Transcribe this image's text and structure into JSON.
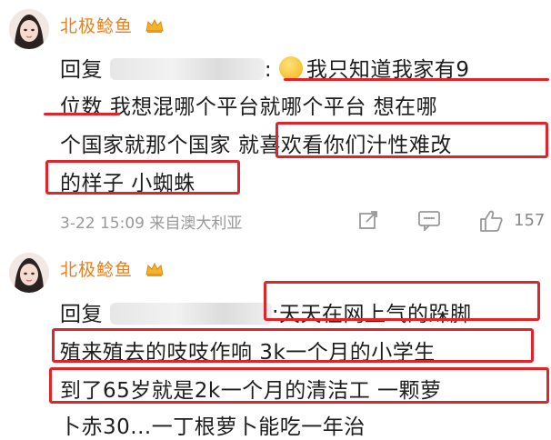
{
  "comment1": {
    "username": "北极鲶鱼",
    "reply_prefix": "回复",
    "colon": ":",
    "line1": "我只知道我家有9",
    "line2a": "位数",
    "line2b": "我想混哪个平台就哪个平台 想在哪",
    "line3a": "个国家就那个国家",
    "line3b": "就喜欢看你们汁性难改",
    "line4": "的样子 小蜘蛛",
    "timestamp": "3-22 15:09",
    "source": "来自澳大利亚",
    "like_count": "157"
  },
  "comment2": {
    "username": "北极鲶鱼",
    "reply_prefix": "回复",
    "line1": ":天天在网上气的跺脚",
    "line2": "殖来殖去的吱吱作响 3k一个月的小学生",
    "line3": "到了65岁就是2k一个月的清洁工 一颗萝",
    "line4_partial": "卜赤30...一丁根萝卜能吃一年治"
  },
  "colors": {
    "username": "#ea8021",
    "highlight": "#e0242a",
    "meta": "#999999"
  },
  "icons": [
    "avatar",
    "vip-crown-badge",
    "emoji-thinking",
    "share-icon",
    "comment-icon",
    "like-icon"
  ]
}
